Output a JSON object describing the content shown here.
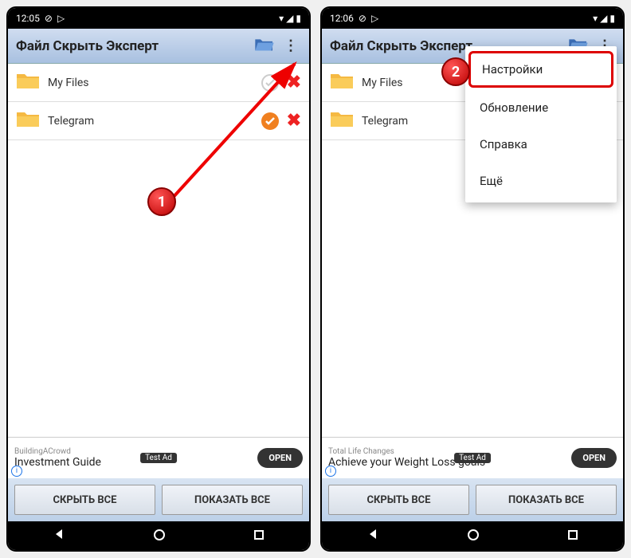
{
  "left": {
    "status_time": "12:05",
    "app_title": "Файл Скрыть Эксперт",
    "rows": [
      {
        "label": "My Files",
        "checked": false
      },
      {
        "label": "Telegram",
        "checked": true
      }
    ],
    "ad": {
      "top": "BuildingACrowd",
      "main": "Investment Guide",
      "tag": "Test Ad",
      "open": "OPEN"
    },
    "btn_hide": "СКРЫТЬ ВСЕ",
    "btn_show": "ПОКАЗАТЬ ВСЕ"
  },
  "right": {
    "status_time": "12:06",
    "app_title": "Файл Скрыть Эксперт",
    "rows": [
      {
        "label": "My Files"
      },
      {
        "label": "Telegram"
      }
    ],
    "menu": {
      "item0": "Настройки",
      "item1": "Обновление",
      "item2": "Справка",
      "item3": "Ещё"
    },
    "ad": {
      "top": "Total Life Changes",
      "main": "Achieve your Weight Loss goals",
      "tag": "Test Ad",
      "open": "OPEN"
    },
    "btn_hide": "СКРЫТЬ ВСЕ",
    "btn_show": "ПОКАЗАТЬ ВСЕ"
  },
  "annotations": {
    "step1": "1",
    "step2": "2"
  }
}
